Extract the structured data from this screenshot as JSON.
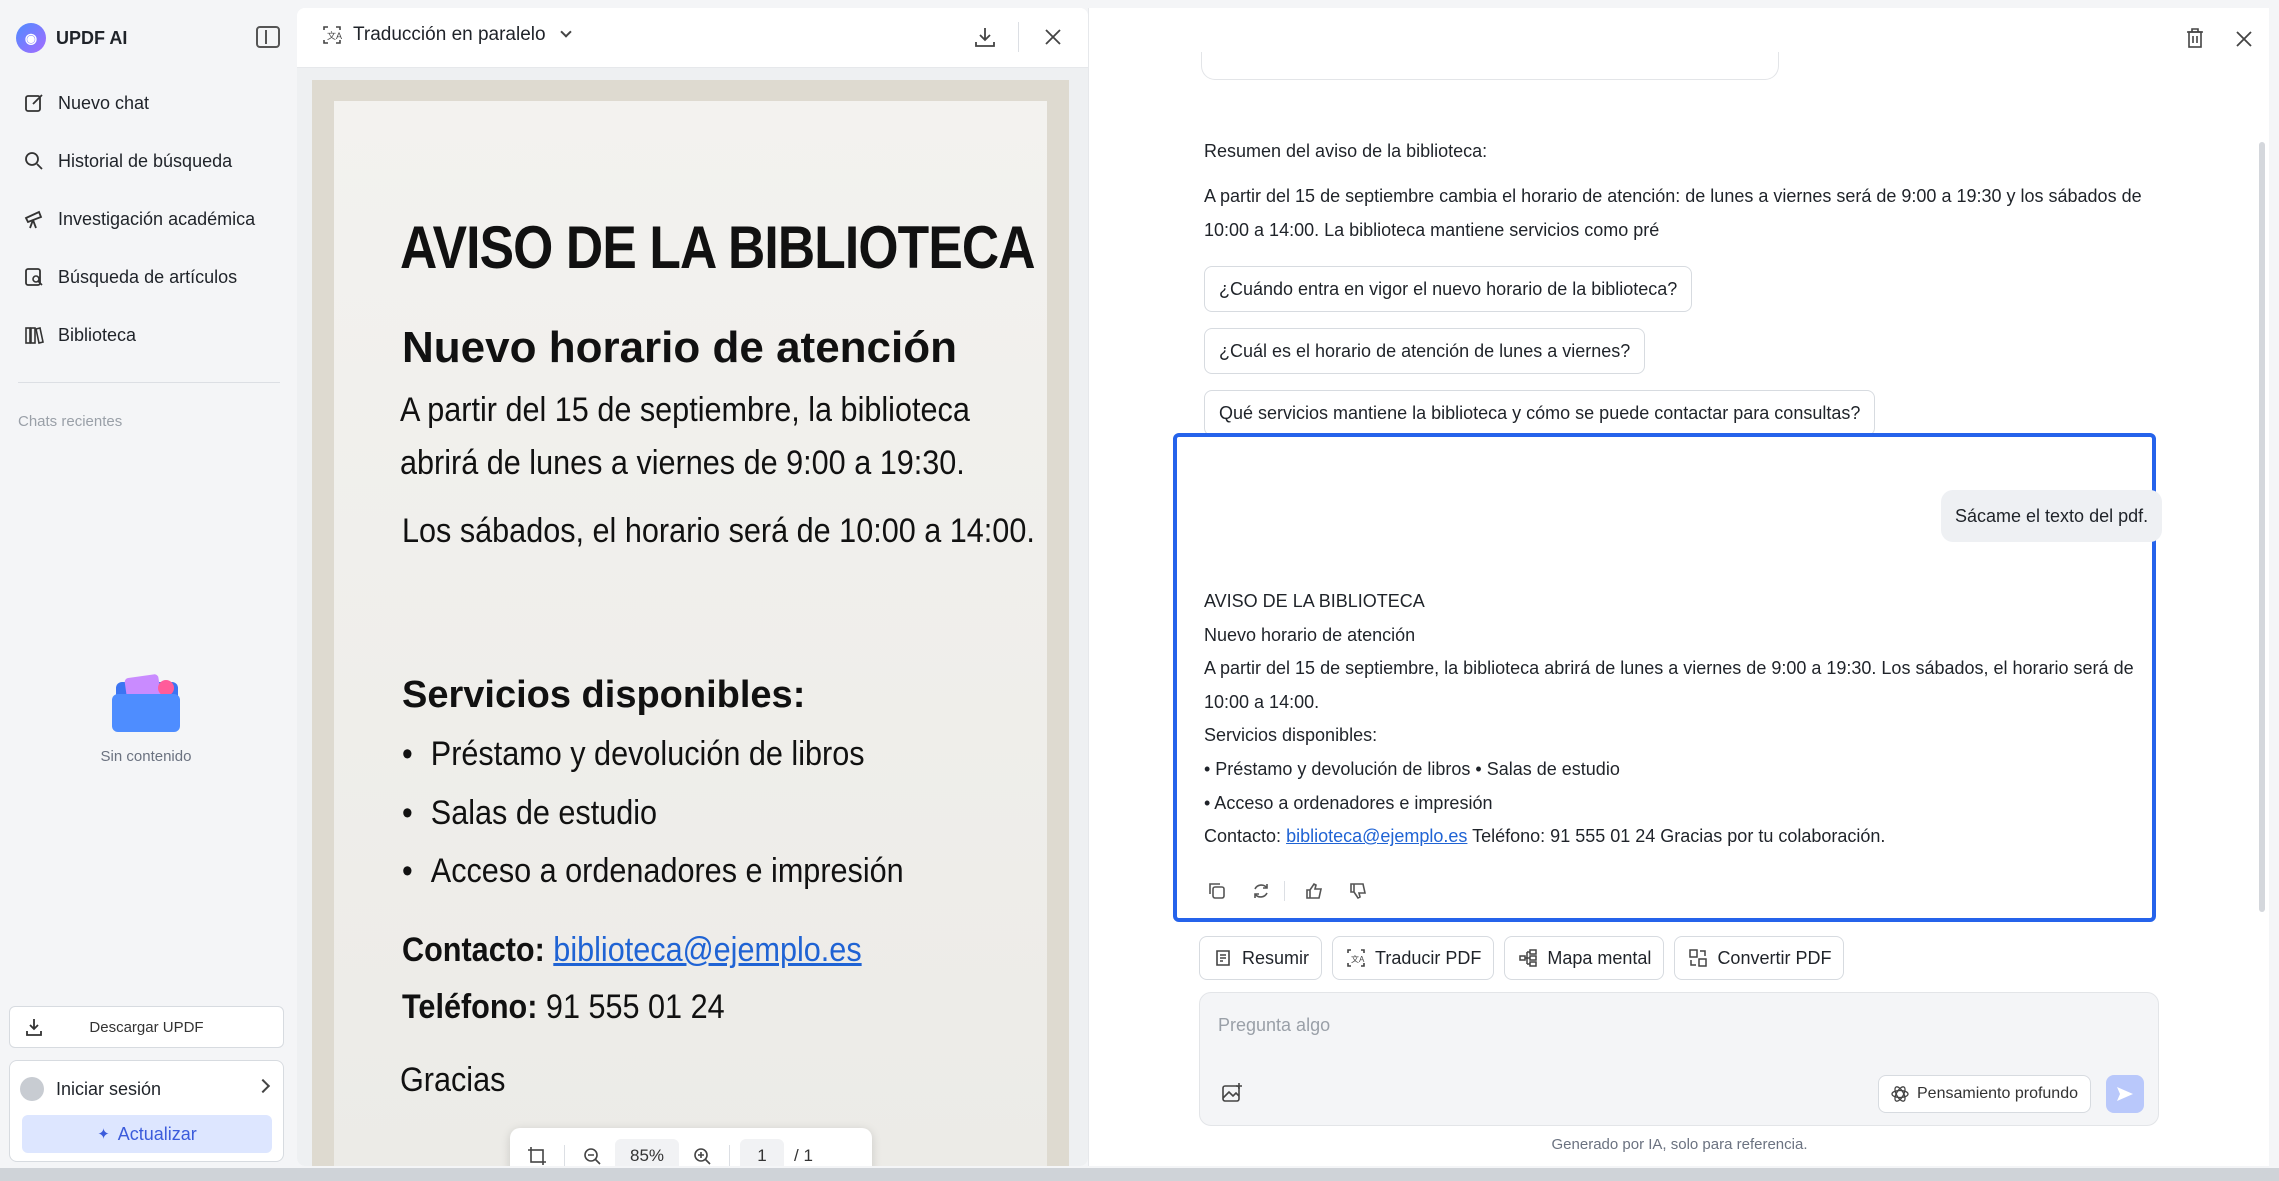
{
  "sidebar": {
    "brand": "UPDF AI",
    "items": [
      {
        "label": "Nuevo chat",
        "icon": "edit-icon"
      },
      {
        "label": "Historial de búsqueda",
        "icon": "search-icon"
      },
      {
        "label": "Investigación académica",
        "icon": "telescope-icon"
      },
      {
        "label": "Búsqueda de artículos",
        "icon": "document-search-icon"
      },
      {
        "label": "Biblioteca",
        "icon": "library-icon"
      }
    ],
    "recent_label": "Chats recientes",
    "empty_text": "Sin contenido",
    "download_label": "Descargar UPDF",
    "login_label": "Iniciar sesión",
    "upgrade_label": "Actualizar"
  },
  "pdf": {
    "mode_label": "Traducción en paralelo",
    "doc": {
      "title": "AVISO DE LA BIBLIOTECA",
      "subtitle": "Nuevo horario de atención",
      "line1": "A partir del 15 de septiembre, la biblioteca",
      "line2": "abrirá de lunes a viernes de 9:00 a 19:30.",
      "line3": "Los sábados, el horario será de 10:00 a 14:00.",
      "services_heading": "Servicios disponibles:",
      "services": [
        "Préstamo y devolución de libros",
        "Salas de estudio",
        "Acceso a ordenadores e impresión"
      ],
      "contact_label": "Contacto:",
      "contact_email": "biblioteca@ejemplo.es",
      "phone_label": "Teléfono:",
      "phone": "91 555 01 24",
      "thanks_partial": "Gracias"
    },
    "zoom": "85%",
    "page_current": "1",
    "page_total": "/ 1"
  },
  "chat": {
    "summary_heading": "Resumen del aviso de la biblioteca:",
    "summary_line1": "A partir del 15 de septiembre cambia el horario de atención: de lunes a viernes será de 9:00 a 19:30 y los sábados de",
    "summary_line2": "10:00 a 14:00. La biblioteca mantiene servicios como pré",
    "suggestions": [
      "¿Cuándo entra en vigor el nuevo horario de la biblioteca?",
      "¿Cuál es el horario de atención de lunes a viernes?",
      "Qué servicios mantiene la biblioteca y cómo se puede contactar para consultas?"
    ],
    "user_message": "Sácame el texto del pdf.",
    "answer": {
      "l1": "AVISO DE LA BIBLIOTECA",
      "l2": "Nuevo horario de atención",
      "l3": "A partir del 15 de septiembre, la biblioteca abrirá de lunes a viernes de 9:00 a 19:30. Los sábados, el horario será de",
      "l4": "10:00 a 14:00.",
      "l5": "Servicios disponibles:",
      "l6": "• Préstamo y devolución de libros • Salas de estudio",
      "l7": "• Acceso a ordenadores e impresión",
      "contact_prefix": "Contacto:",
      "contact_email": "biblioteca@ejemplo.es",
      "contact_suffix": "Teléfono: 91 555 01 24 Gracias por tu colaboración."
    },
    "quick_actions": [
      {
        "label": "Resumir",
        "icon": "summary-icon"
      },
      {
        "label": "Traducir PDF",
        "icon": "translate-icon"
      },
      {
        "label": "Mapa mental",
        "icon": "mind-map-icon"
      },
      {
        "label": "Convertir PDF",
        "icon": "convert-icon"
      }
    ],
    "input_placeholder": "Pregunta algo",
    "deep_think_label": "Pensamiento profundo",
    "disclaimer": "Generado por IA, solo para referencia."
  },
  "colors": {
    "accent": "#2563eb",
    "link": "#1f63d4",
    "upgrade_bg": "#dde6ff",
    "send_disabled": "#b9c8fb"
  }
}
